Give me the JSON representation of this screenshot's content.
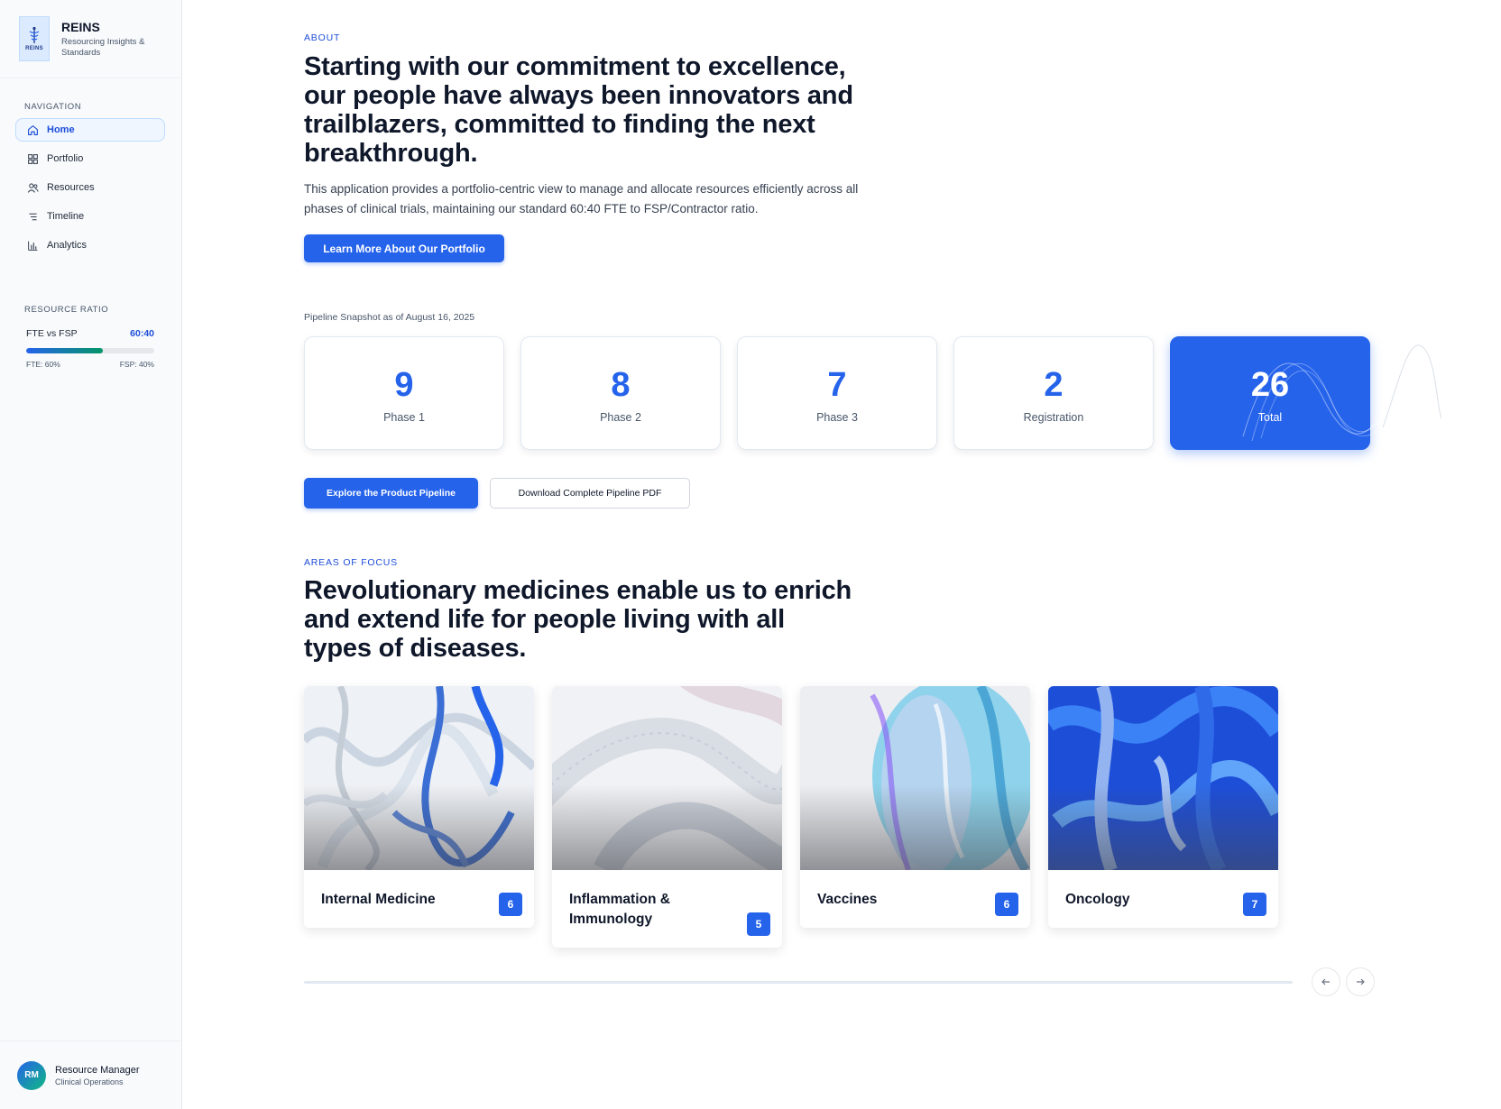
{
  "brand": {
    "logo_word": "REINS",
    "name": "REINS",
    "tagline": "Resourcing Insights & Standards"
  },
  "sidebar": {
    "nav_heading": "NAVIGATION",
    "items": [
      {
        "label": "Home",
        "icon": "home-icon",
        "active": true
      },
      {
        "label": "Portfolio",
        "icon": "grid-icon",
        "active": false
      },
      {
        "label": "Resources",
        "icon": "users-icon",
        "active": false
      },
      {
        "label": "Timeline",
        "icon": "list-icon",
        "active": false
      },
      {
        "label": "Analytics",
        "icon": "bar-chart-icon",
        "active": false
      }
    ],
    "ratio_heading": "RESOURCE RATIO",
    "ratio": {
      "label": "FTE vs FSP",
      "value": "60:40",
      "fte_fraction": 0.6,
      "fte_label": "FTE: 60%",
      "fsp_label": "FSP: 40%"
    },
    "user": {
      "initials": "RM",
      "name": "Resource Manager",
      "role": "Clinical Operations"
    }
  },
  "about": {
    "eyebrow": "ABOUT",
    "headline_lines": [
      "Starting with our commitment to excellence,",
      "our people have always been innovators and",
      "trailblazers, committed to finding the next",
      "breakthrough."
    ],
    "lead": "This application provides a portfolio-centric view to manage and allocate resources efficiently across all phases of clinical trials, maintaining our standard 60:40 FTE to FSP/Contractor ratio.",
    "cta": "Learn More About Our Portfolio"
  },
  "pipeline": {
    "snapshot_label": "Pipeline Snapshot as of August 16, 2025",
    "stats": [
      {
        "value": "9",
        "label": "Phase 1"
      },
      {
        "value": "8",
        "label": "Phase 2"
      },
      {
        "value": "7",
        "label": "Phase 3"
      },
      {
        "value": "2",
        "label": "Registration"
      },
      {
        "value": "26",
        "label": "Total"
      }
    ],
    "explore_button": "Explore the Product Pipeline",
    "download_button": "Download Complete Pipeline PDF"
  },
  "focus": {
    "eyebrow": "AREAS OF FOCUS",
    "headline_lines": [
      "Revolutionary medicines enable us to enrich",
      "and extend life for people living with all",
      "types of diseases."
    ],
    "cards": [
      {
        "title": "Internal Medicine",
        "count": "6"
      },
      {
        "title": "Inflammation & Immunology",
        "count": "5"
      },
      {
        "title": "Vaccines",
        "count": "6"
      },
      {
        "title": "Oncology",
        "count": "7"
      }
    ]
  },
  "carousel": {
    "prev_icon": "arrow-left-icon",
    "next_icon": "arrow-right-icon"
  },
  "colors": {
    "primary": "#2563eb",
    "accent_green": "#059669",
    "text": "#0f172a"
  }
}
